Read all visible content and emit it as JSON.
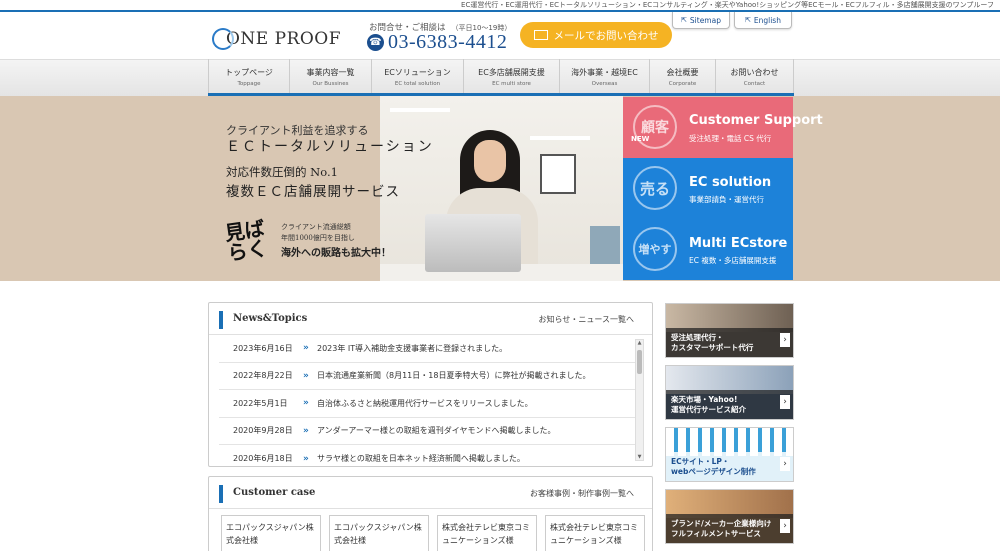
{
  "tagline": "EC運営代行・EC運用代行・ECトータルソリューション・ECコンサルティング・楽天やYahoo!ショッピング等ECモール・ECフルフィル・多店舗展開支援のワンプルーフ",
  "header": {
    "logo_text": "ONE PROOF",
    "contact_caption": "お問合せ・ご相談は",
    "contact_hours": "（平日10〜19時）",
    "phone_number": "03-6383-4412",
    "mail_button": "メールでお問い合わせ",
    "lang_sitemap": "Sitemap",
    "lang_english": "English"
  },
  "nav": [
    {
      "jp": "トップページ",
      "en": "Toppage"
    },
    {
      "jp": "事業内容一覧",
      "en": "Our Bussines"
    },
    {
      "jp": "ECソリューション",
      "en": "EC total solution"
    },
    {
      "jp": "EC多店舗展開支援",
      "en": "EC multi store"
    },
    {
      "jp": "海外事業・越境EC",
      "en": "Overseas"
    },
    {
      "jp": "会社概要",
      "en": "Corporate"
    },
    {
      "jp": "お問い合わせ",
      "en": "Contact"
    }
  ],
  "hero": {
    "line1": "クライアント利益を追求する",
    "line2": "ＥＣトータルソリューション",
    "line3": "対応件数圧倒的 No.1",
    "line4": "複数ＥＣ店舗展開サービス",
    "callig": "見ばらく",
    "small1": "クライアント流通総額",
    "small2": "年間1000億円を目指し",
    "small3": "海外への販路も拡大中！"
  },
  "services": [
    {
      "kanji": "顧客",
      "new": "NEW",
      "title": "Customer Support",
      "sub": "受注処理・電話 CS 代行",
      "color": "#e96a79"
    },
    {
      "kanji": "売る",
      "new": "",
      "title": "EC solution",
      "sub": "事業部請負・運営代行",
      "color": "#1d82d9"
    },
    {
      "kanji": "増やす",
      "new": "",
      "title": "Multi ECstore",
      "sub": "EC 複数・多店舗展開支援",
      "color": "#1d82d9"
    }
  ],
  "news": {
    "title": "News&Topics",
    "more": "お知らせ・ニュース一覧へ",
    "items": [
      {
        "date": "2023年6月16日",
        "text": "2023年 IT導入補助金支援事業者に登録されました。"
      },
      {
        "date": "2022年8月22日",
        "text": "日本流通産業新聞（8月11日・18日夏季特大号）に弊社が掲載されました。"
      },
      {
        "date": "2022年5月1日",
        "text": "自治体ふるさと納税運用代行サービスをリリースしました。"
      },
      {
        "date": "2020年9月28日",
        "text": "アンダーアーマー様との取組を週刊ダイヤモンドへ掲載しました。"
      },
      {
        "date": "2020年6月18日",
        "text": "サラヤ様との取組を日本ネット経済新聞へ掲載しました。"
      }
    ]
  },
  "case": {
    "title": "Customer case",
    "more": "お客様事例・制作事例一覧へ",
    "cards": [
      {
        "l1": "エコパックスジャパン株",
        "l2": "式会社様"
      },
      {
        "l1": "エコパックスジャパン株",
        "l2": "式会社様"
      },
      {
        "l1": "株式会社テレビ東京コミ",
        "l2": "ュニケーションズ様"
      },
      {
        "l1": "株式会社テレビ東京コミ",
        "l2": "ュニケーションズ様"
      }
    ]
  },
  "side_banners": [
    {
      "l1": "受注処理代行・",
      "l2": "カスタマーサポート代行",
      "color": "#7a6a5a"
    },
    {
      "l1": "楽天市場・Yahoo!",
      "l2": "運営代行サービス紹介",
      "color": "#5a7aa0"
    },
    {
      "l1": "ECサイト・LP・",
      "l2": "webページデザイン制作",
      "color": "#3aa0d8"
    },
    {
      "l1": "ブランド/メーカー企業様向け",
      "l2": "フルフィルメントサービス",
      "color": "#c0905a"
    }
  ]
}
